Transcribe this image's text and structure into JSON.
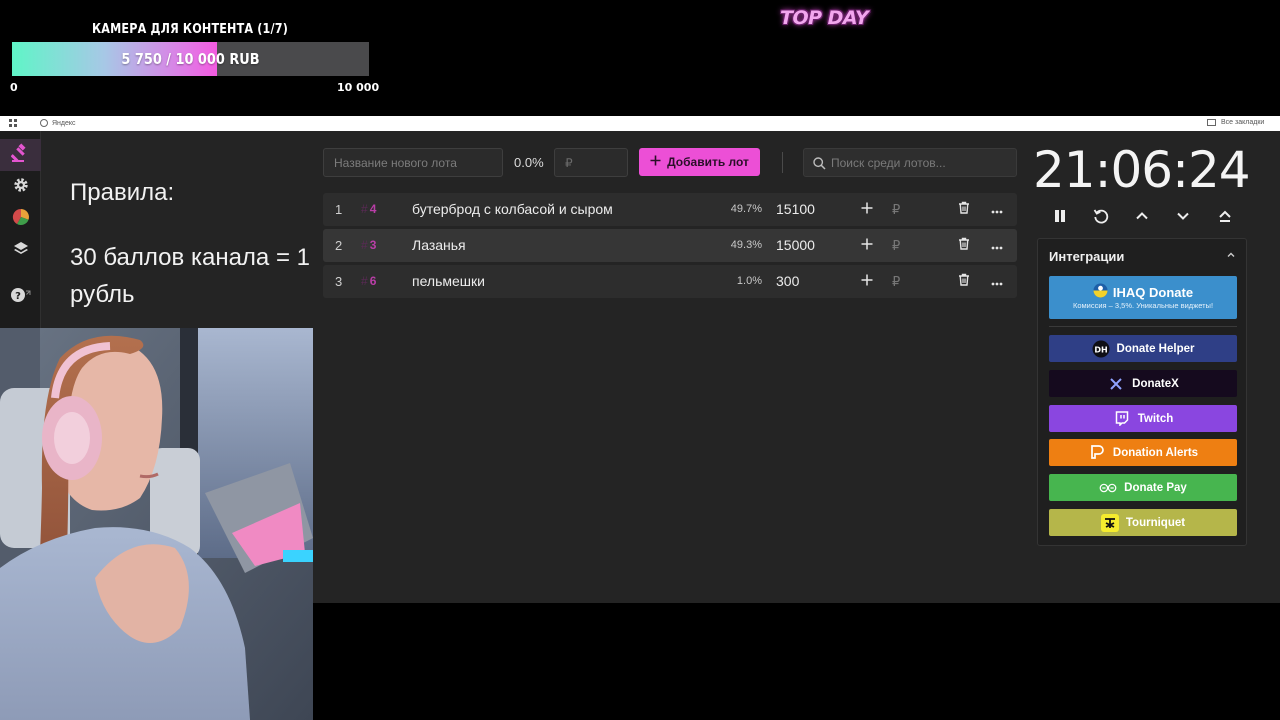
{
  "goal": {
    "title": "КАМЕРА ДЛЯ КОНТЕНТА (1/7)",
    "current": 5750,
    "target": 10000,
    "progress_text": "5 750 / 10 000 RUB",
    "min_label": "0",
    "max_label": "10 000"
  },
  "top_day": "TOP DAY",
  "browser": {
    "bookmark_yandex": "Яндекс",
    "all_bookmarks": "Все закладки"
  },
  "rules": {
    "title": "Правила:",
    "body": "30 баллов канала = 1 рубль"
  },
  "toolbar": {
    "lot_name_placeholder": "Название нового лота",
    "percent": "0.0%",
    "amount_placeholder": "₽",
    "add_lot_label": "Добавить лот",
    "search_placeholder": "Поиск среди лотов..."
  },
  "lots": [
    {
      "num": "1",
      "id": "4",
      "name": "бутерброд с колбасой и сыром",
      "percent": "49.7%",
      "amount": "15100",
      "currency": "₽"
    },
    {
      "num": "2",
      "id": "3",
      "name": "Лазанья",
      "percent": "49.3%",
      "amount": "15000",
      "currency": "₽"
    },
    {
      "num": "3",
      "id": "6",
      "name": "пельмешки",
      "percent": "1.0%",
      "amount": "300",
      "currency": "₽"
    }
  ],
  "timer": {
    "time": "21:06:24"
  },
  "integrations": {
    "title": "Интеграции",
    "ihaq": {
      "title": "IHAQ Donate",
      "subtitle": "Комиссия – 3,5%. Уникальные виджеты!"
    },
    "buttons": [
      {
        "label": "Donate Helper",
        "color": "#2f3f86",
        "icon": "donate-helper-logo"
      },
      {
        "label": "DonateX",
        "color": "#150a1e",
        "icon": "donatex-logo"
      },
      {
        "label": "Twitch",
        "color": "#8a46e0",
        "icon": "twitch-logo"
      },
      {
        "label": "Donation Alerts",
        "color": "#ee7f12",
        "icon": "donationalerts-logo"
      },
      {
        "label": "Donate Pay",
        "color": "#47b54f",
        "icon": "donatepay-logo"
      },
      {
        "label": "Tourniquet",
        "color": "#b5b64a",
        "icon": "tourniquet-logo"
      }
    ]
  },
  "colors": {
    "accent": "#ec4fd6",
    "background": "#242424",
    "lot_id": "#b93ea7"
  }
}
